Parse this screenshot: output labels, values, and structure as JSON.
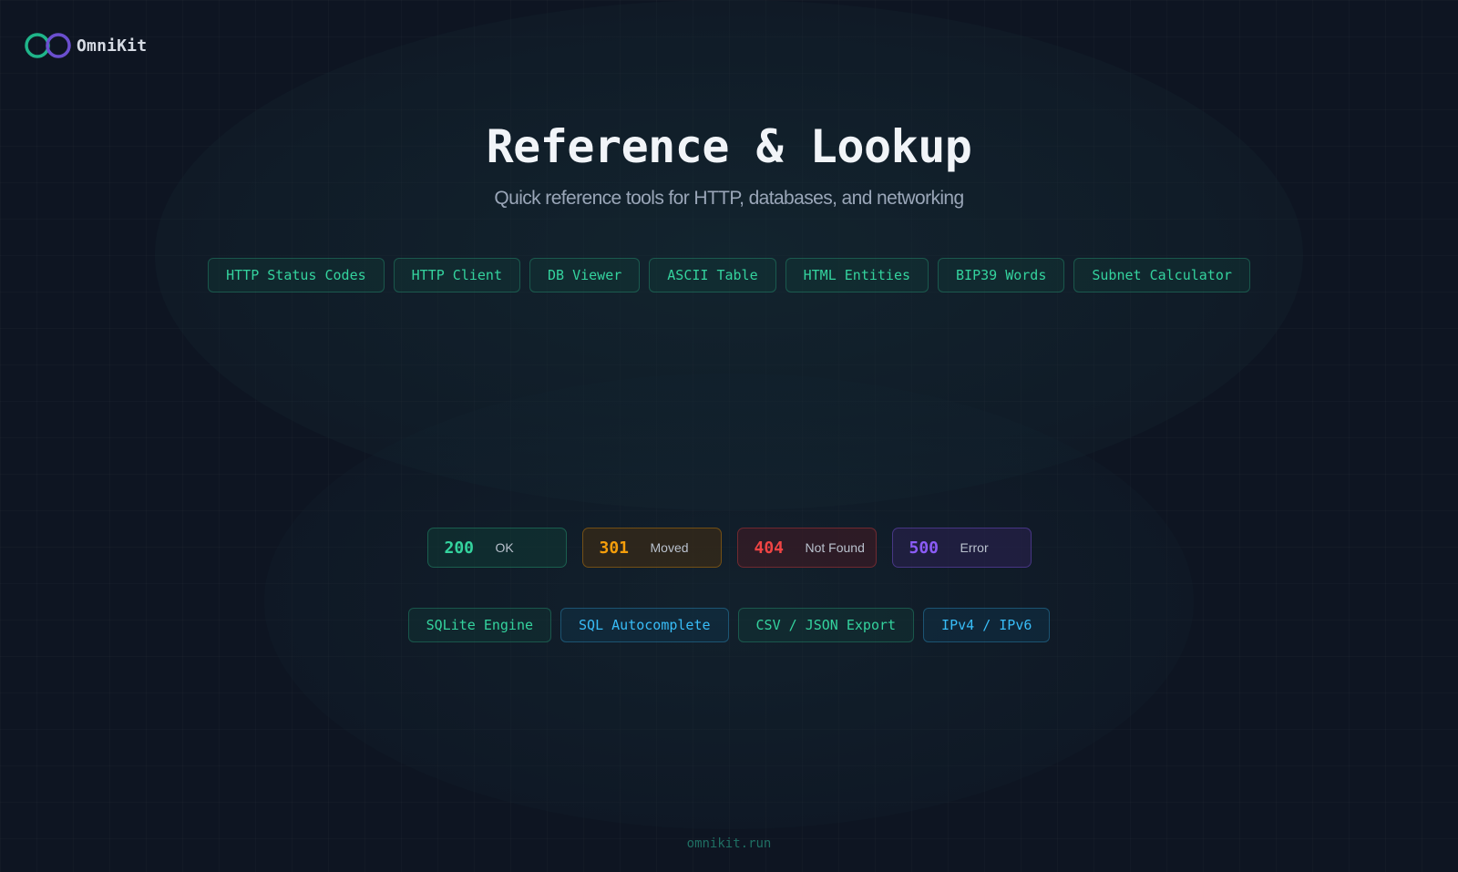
{
  "brand": {
    "name": "OmniKit",
    "logo_icon": "infinity-rings-icon",
    "colors": {
      "ring_left": "#1fb58a",
      "ring_right": "#6b4fcf"
    }
  },
  "hero": {
    "title": "Reference & Lookup",
    "subtitle": "Quick reference tools for HTTP, databases, and networking"
  },
  "tools": [
    {
      "label": "HTTP Status Codes"
    },
    {
      "label": "HTTP Client"
    },
    {
      "label": "DB Viewer"
    },
    {
      "label": "ASCII Table"
    },
    {
      "label": "HTML Entities"
    },
    {
      "label": "BIP39 Words"
    },
    {
      "label": "Subnet Calculator"
    }
  ],
  "status_codes": [
    {
      "code": "200",
      "text": "OK",
      "color": "#34d39e",
      "border": "rgba(52,211,153,0.30)",
      "bg": "rgba(16,64,56,0.45)"
    },
    {
      "code": "301",
      "text": "Moved",
      "color": "#f59e0b",
      "border": "rgba(245,158,11,0.35)",
      "bg": "rgba(70,46,16,0.55)"
    },
    {
      "code": "404",
      "text": "Not Found",
      "color": "#ef4444",
      "border": "rgba(239,68,68,0.35)",
      "bg": "rgba(70,26,34,0.55)"
    },
    {
      "code": "500",
      "text": "Error",
      "color": "#8b5cf6",
      "border": "rgba(139,92,246,0.38)",
      "bg": "rgba(44,32,82,0.55)"
    }
  ],
  "features": [
    {
      "label": "SQLite Engine",
      "color": "#34d39e",
      "border": "rgba(52,211,153,0.28)",
      "bg": "rgba(16,64,56,0.35)"
    },
    {
      "label": "SQL Autocomplete",
      "color": "#38bdf8",
      "border": "rgba(56,189,248,0.30)",
      "bg": "rgba(16,56,80,0.40)"
    },
    {
      "label": "CSV / JSON Export",
      "color": "#34d39e",
      "border": "rgba(52,211,153,0.28)",
      "bg": "rgba(16,64,56,0.35)"
    },
    {
      "label": "IPv4 / IPv6",
      "color": "#38bdf8",
      "border": "rgba(56,189,248,0.30)",
      "bg": "rgba(16,56,80,0.40)"
    }
  ],
  "footer": {
    "url": "omnikit.run"
  }
}
